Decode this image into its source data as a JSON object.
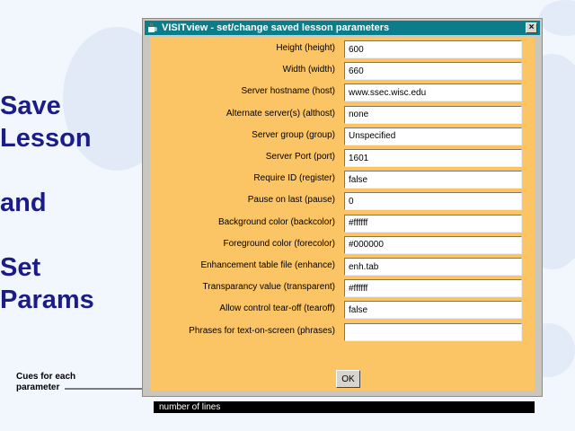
{
  "slide": {
    "title_lines": [
      "Save",
      "Lesson",
      "",
      "and",
      "",
      "Set",
      "Params"
    ],
    "cue_note": "Cues for each parameter"
  },
  "dialog": {
    "title": "VISITview - set/change saved lesson parameters",
    "close_label": "×",
    "fields": [
      {
        "label": "Height (height)",
        "value": "600"
      },
      {
        "label": "Width (width)",
        "value": "660"
      },
      {
        "label": "Server hostname (host)",
        "value": "www.ssec.wisc.edu"
      },
      {
        "label": "Alternate server(s) (althost)",
        "value": "none"
      },
      {
        "label": "Server group (group)",
        "value": "Unspecified"
      },
      {
        "label": "Server Port (port)",
        "value": "1601"
      },
      {
        "label": "Require ID (register)",
        "value": "false"
      },
      {
        "label": "Pause on last (pause)",
        "value": "0"
      },
      {
        "label": "Background color (backcolor)",
        "value": "#ffffff"
      },
      {
        "label": "Foreground color (forecolor)",
        "value": "#000000"
      },
      {
        "label": "Enhancement table file (enhance)",
        "value": "enh.tab"
      },
      {
        "label": "Transparancy value (transparent)",
        "value": "#ffffff"
      },
      {
        "label": "Allow control tear-off (tearoff)",
        "value": "false"
      },
      {
        "label": "Phrases for text-on-screen (phrases)",
        "value": ""
      }
    ],
    "ok_label": "OK",
    "status_text": "number of lines"
  },
  "colors": {
    "slide_text": "#1b1c87",
    "titlebar": "#0b7c8a",
    "panel": "#fbc464"
  }
}
